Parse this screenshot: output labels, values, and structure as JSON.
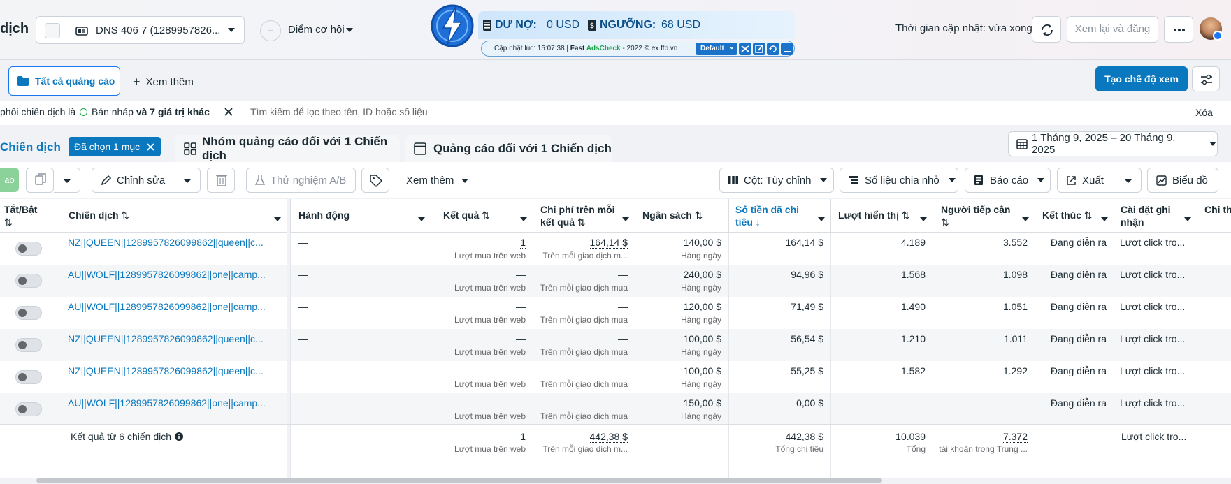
{
  "header": {
    "title": "dịch",
    "account_name": "DNS 406 7 (1289957826...",
    "opportunity_score_placeholder": "--",
    "opportunity_label": "Điểm cơ hội",
    "updated_text": "Thời gian cập nhật: vừa xong",
    "review_publish": "Xem lại và đăng"
  },
  "extension": {
    "debt_label": "DƯ NỢ:",
    "debt_value": "0 USD",
    "threshold_label": "NGƯỠNG:",
    "threshold_value": "68 USD",
    "footer_text_prefix": "Cập nhật lúc: 15:07:38 | ",
    "footer_fast": "Fast ",
    "footer_brand": "AdsCheck",
    "footer_suffix": " - 2022 © ex.ffb.vn",
    "default_label": "Default"
  },
  "toolbar2": {
    "all_ads": "Tất cả quảng cáo",
    "see_more": "Xem thêm",
    "create_view": "Tạo chế độ xem"
  },
  "filter": {
    "prefix": "phối chiến dịch là",
    "draft": "Bản nháp",
    "extra": "và 7 giá trị khác",
    "search_placeholder": "Tìm kiếm để lọc theo tên, ID hoặc số liệu",
    "clear": "Xóa"
  },
  "tabs": {
    "campaigns": "Chiến dịch",
    "selected": "Đã chọn 1 mục",
    "adsets": "Nhóm quảng cáo đối với 1 Chiến dịch",
    "ads": "Quảng cáo đối với 1 Chiến dịch",
    "date_range": "1 Tháng 9, 2025 – 20 Tháng 9, 2025"
  },
  "actions": {
    "publish_stub": "ao",
    "edit": "Chỉnh sửa",
    "ab_test": "Thử nghiệm A/B",
    "see_more": "Xem thêm",
    "columns": "Cột: Tùy chỉnh",
    "breakdown": "Số liệu chia nhỏ",
    "reports": "Báo cáo",
    "export": "Xuất",
    "charts": "Biểu đồ"
  },
  "table": {
    "headers": {
      "toggle": "Tắt/Bật",
      "campaign": "Chiến dịch",
      "action": "Hành động",
      "results": "Kết quả",
      "cpr": "Chi phí trên mỗi kết quả",
      "budget": "Ngân sách",
      "spent": "Số tiền đã chi tiêu",
      "impressions": "Lượt hiển thị",
      "reach": "Người tiếp cận",
      "ends": "Kết thúc",
      "attribution": "Cài đặt ghi nhận",
      "cost_cut": "Chi thầu"
    },
    "rows": [
      {
        "name": "NZ||QUEEN||1289957826099862||queen||c...",
        "action": "—",
        "result": "1",
        "result_sub": "Lượt mua trên web",
        "cpr": "164,14 $",
        "cpr_sub": "Trên mỗi giao dịch m...",
        "budget": "140,00 $",
        "budget_sub": "Hàng ngày",
        "spent": "164,14 $",
        "impr": "4.189",
        "reach": "3.552",
        "ends": "Đang diễn ra",
        "attr": "Lượt click tro..."
      },
      {
        "name": "AU||WOLF||1289957826099862||one||camp...",
        "action": "—",
        "result": "—",
        "result_sub": "Lượt mua trên web",
        "cpr": "—",
        "cpr_sub": "Trên mỗi giao dịch mua",
        "budget": "240,00 $",
        "budget_sub": "Hàng ngày",
        "spent": "94,96 $",
        "impr": "1.568",
        "reach": "1.098",
        "ends": "Đang diễn ra",
        "attr": "Lượt click tro..."
      },
      {
        "name": "AU||WOLF||1289957826099862||one||camp...",
        "action": "—",
        "result": "—",
        "result_sub": "Lượt mua trên web",
        "cpr": "—",
        "cpr_sub": "Trên mỗi giao dịch mua",
        "budget": "120,00 $",
        "budget_sub": "Hàng ngày",
        "spent": "71,49 $",
        "impr": "1.490",
        "reach": "1.051",
        "ends": "Đang diễn ra",
        "attr": "Lượt click tro..."
      },
      {
        "name": "NZ||QUEEN||1289957826099862||queen||c...",
        "action": "—",
        "result": "—",
        "result_sub": "Lượt mua trên web",
        "cpr": "—",
        "cpr_sub": "Trên mỗi giao dịch mua",
        "budget": "100,00 $",
        "budget_sub": "Hàng ngày",
        "spent": "56,54 $",
        "impr": "1.210",
        "reach": "1.011",
        "ends": "Đang diễn ra",
        "attr": "Lượt click tro..."
      },
      {
        "name": "NZ||QUEEN||1289957826099862||queen||c...",
        "action": "—",
        "result": "—",
        "result_sub": "Lượt mua trên web",
        "cpr": "—",
        "cpr_sub": "Trên mỗi giao dịch mua",
        "budget": "100,00 $",
        "budget_sub": "Hàng ngày",
        "spent": "55,25 $",
        "impr": "1.582",
        "reach": "1.292",
        "ends": "Đang diễn ra",
        "attr": "Lượt click tro..."
      },
      {
        "name": "AU||WOLF||1289957826099862||one||camp...",
        "action": "—",
        "result": "—",
        "result_sub": "Lượt mua trên web",
        "cpr": "—",
        "cpr_sub": "Trên mỗi giao dịch mua",
        "budget": "150,00 $",
        "budget_sub": "Hàng ngày",
        "spent": "0,00 $",
        "impr": "—",
        "reach": "—",
        "ends": "Đang diễn ra",
        "attr": "Lượt click tro..."
      }
    ],
    "totals": {
      "label": "Kết quả từ 6 chiến dịch",
      "result": "1",
      "result_sub": "Lượt mua trên web",
      "cpr": "442,38 $",
      "cpr_sub": "Trên mỗi giao dịch m...",
      "spent": "442,38 $",
      "spent_sub": "Tổng chi tiêu",
      "impr": "10.039",
      "impr_sub": "Tổng",
      "reach": "7.372",
      "reach_sub": "tài khoản trong Trung ...",
      "attr": "Lượt click tro..."
    }
  },
  "colors": {
    "accent": "#0a78be",
    "brand": "#1877f2",
    "publish_stub": "#8ad19a"
  }
}
